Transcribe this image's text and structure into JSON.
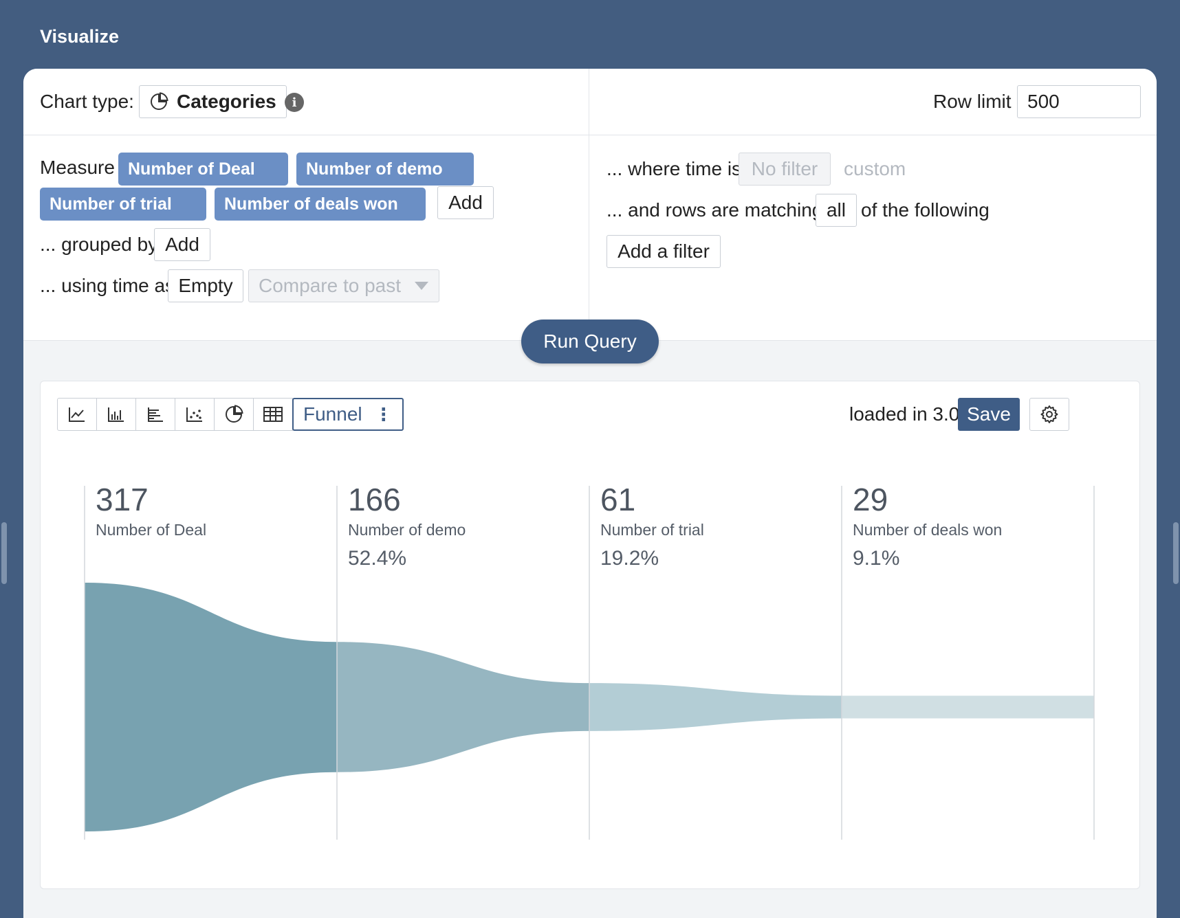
{
  "header": {
    "title": "Visualize"
  },
  "query": {
    "chart_type_label": "Chart type:",
    "chart_type_value": "Categories",
    "row_limit_label": "Row limit",
    "row_limit_value": "500",
    "measure_label": "Measure",
    "measures": [
      "Number of Deal",
      "Number of demo",
      "Number of trial",
      "Number of deals won"
    ],
    "add_label": "Add",
    "grouped_by_label": "... grouped by",
    "grouped_add_label": "Add",
    "time_label": "... using time as",
    "time_value": "Empty",
    "compare_placeholder": "Compare to past",
    "where_time_label": "... where time is",
    "no_filter_label": "No filter",
    "custom_label": "custom",
    "rows_matching_label": "... and rows are matching",
    "match_mode": "all",
    "following_label": "of the following",
    "add_filter_label": "Add a filter",
    "run_query_label": "Run Query"
  },
  "results": {
    "toolbar_icons": [
      "line-chart-icon",
      "bar-chart-icon",
      "horizontal-bar-icon",
      "scatter-icon",
      "pie-chart-icon",
      "table-icon"
    ],
    "active_view": "Funnel",
    "loaded_text": "loaded in 3.065s",
    "save_label": "Save"
  },
  "chart_data": {
    "type": "funnel",
    "stages": [
      {
        "label": "Number of Deal",
        "value": 317,
        "percent": ""
      },
      {
        "label": "Number of demo",
        "value": 166,
        "percent": "52.4%"
      },
      {
        "label": "Number of trial",
        "value": 61,
        "percent": "19.2%"
      },
      {
        "label": "Number of deals won",
        "value": 29,
        "percent": "9.1%"
      }
    ],
    "colors": [
      "#78a2b0",
      "#96b6c1",
      "#b3cdd5",
      "#d0dfe3"
    ]
  }
}
